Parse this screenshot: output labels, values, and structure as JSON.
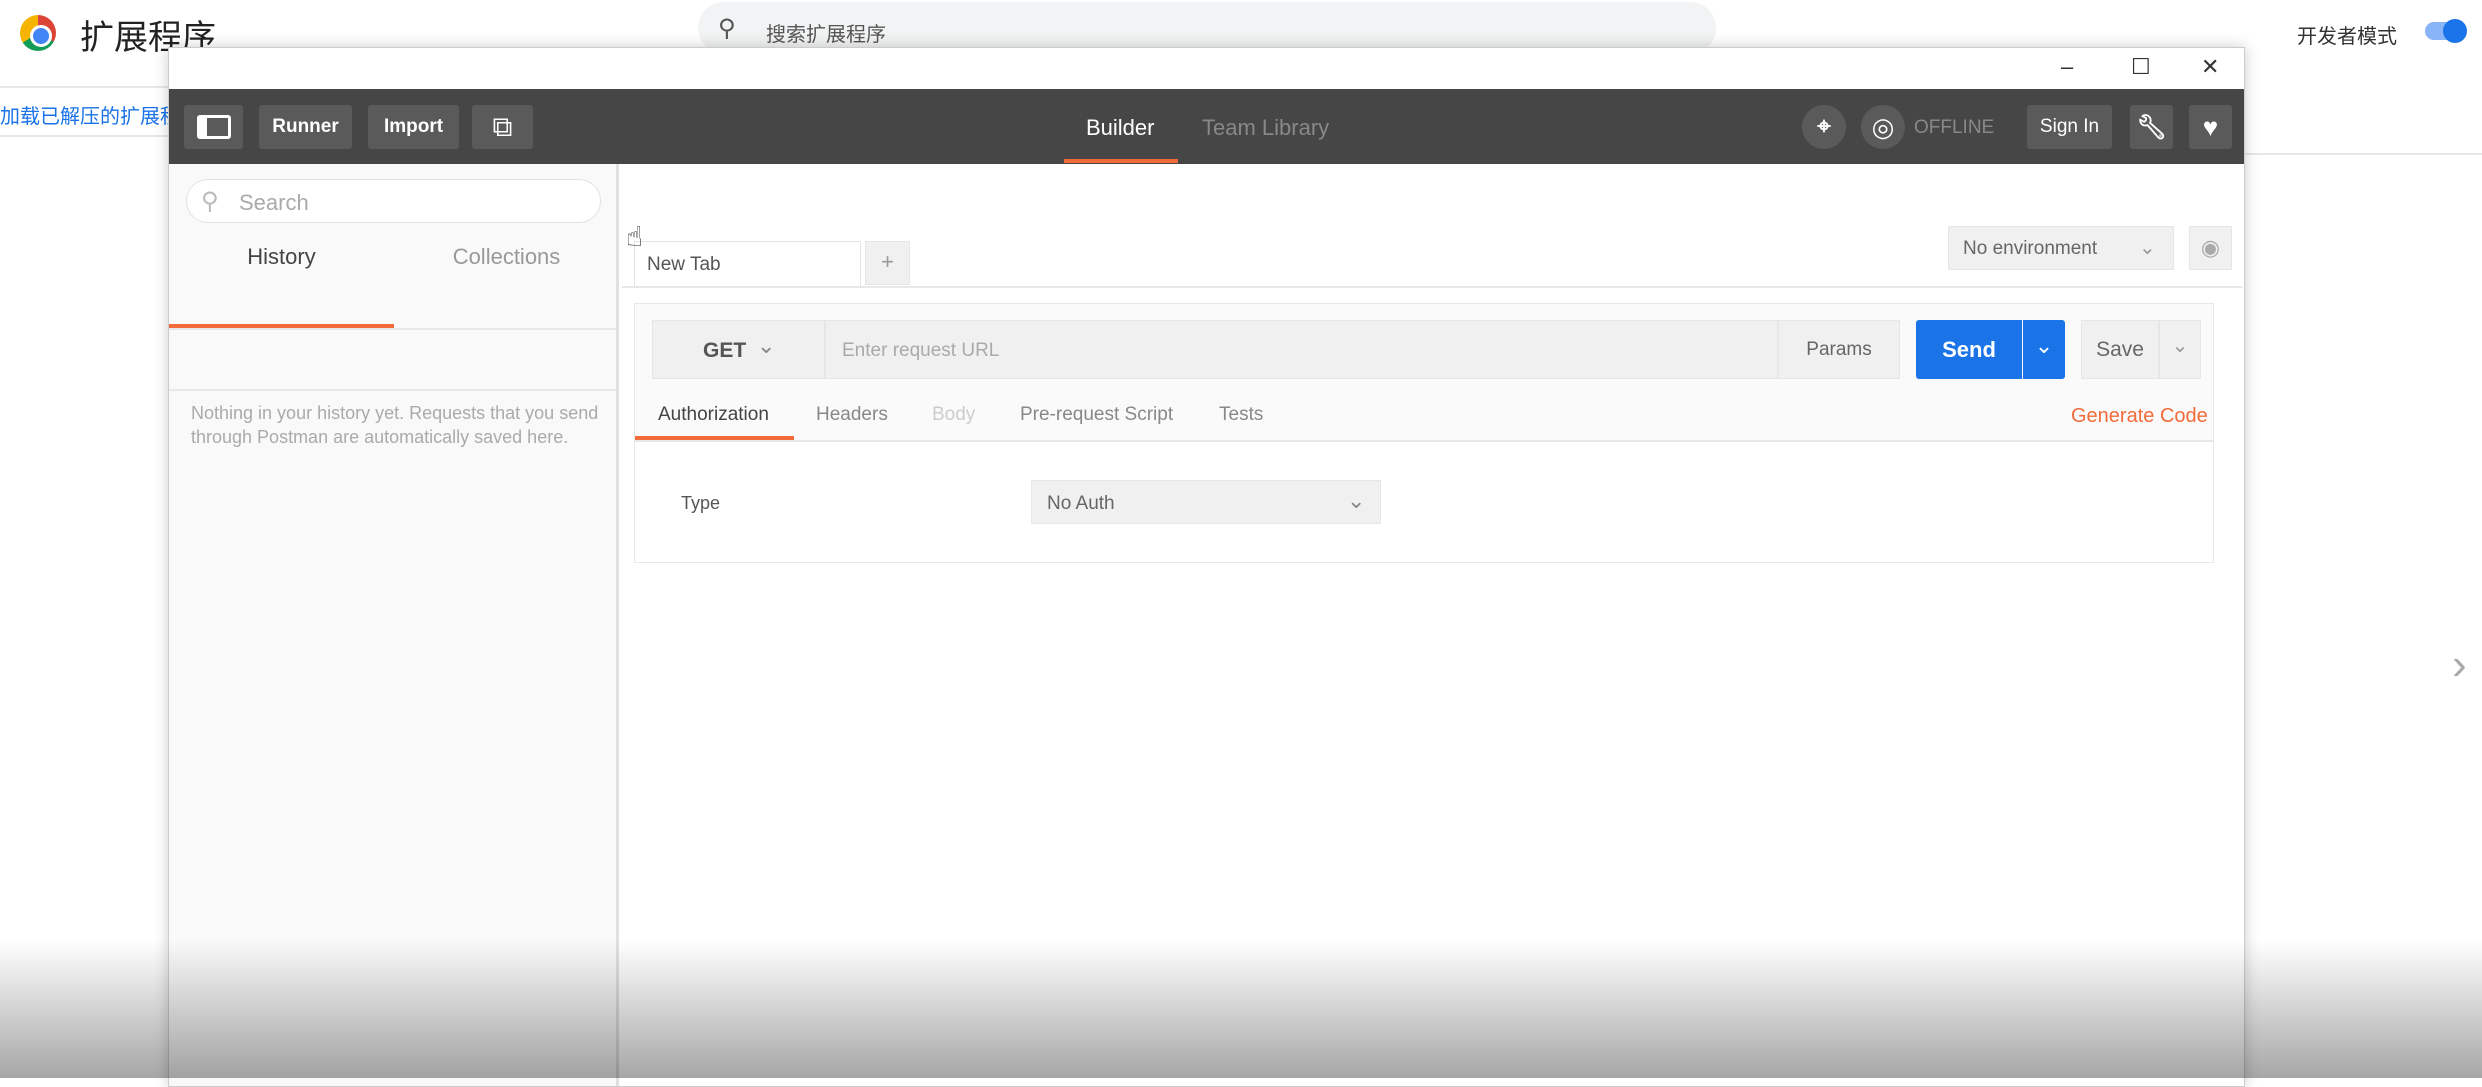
{
  "chrome": {
    "title": "扩展程序",
    "search_placeholder": "搜索扩展程序",
    "dev_mode_label": "开发者模式",
    "dev_mode_on": true,
    "load_unpacked": "加载已解压的扩展程序"
  },
  "window_controls": {
    "minimize": "–",
    "maximize": "☐",
    "close": "✕"
  },
  "toolbar": {
    "runner": "Runner",
    "import": "Import",
    "tabs": [
      {
        "label": "Builder",
        "active": true
      },
      {
        "label": "Team Library",
        "active": false
      }
    ],
    "offline": "OFFLINE",
    "sign_in": "Sign In"
  },
  "sidebar": {
    "search_placeholder": "Search",
    "tabs": [
      {
        "label": "History",
        "active": true
      },
      {
        "label": "Collections",
        "active": false
      }
    ],
    "empty_text": "Nothing in your history yet. Requests that you send through Postman are automatically saved here."
  },
  "main": {
    "tab": "New Tab",
    "add_tab": "+",
    "environment": "No environment",
    "method": "GET",
    "url_placeholder": "Enter request URL",
    "params": "Params",
    "send": "Send",
    "save": "Save",
    "subtabs": [
      "Authorization",
      "Headers",
      "Body",
      "Pre-request Script",
      "Tests"
    ],
    "generate_code": "Generate Code",
    "type_label": "Type",
    "auth_value": "No Auth"
  },
  "colors": {
    "accent": "#f26b3a",
    "send": "#1a74e8",
    "toolbar": "#464646"
  }
}
